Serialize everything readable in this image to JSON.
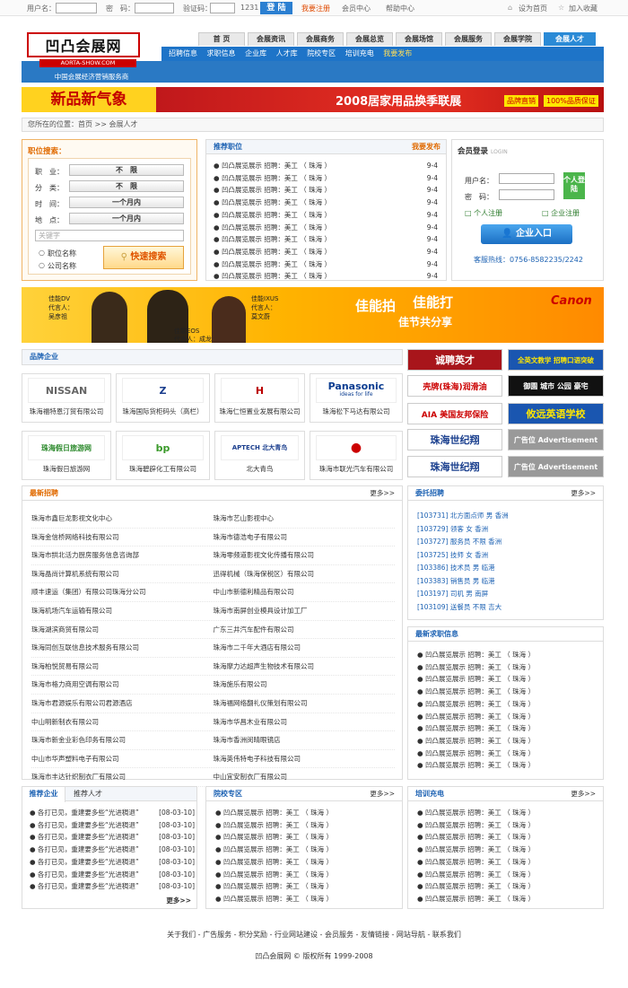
{
  "topbar": {
    "username_label": "用户名：",
    "password_label": "密　码：",
    "captcha_label": "验证码：",
    "captcha_value": "1231",
    "login_btn": "登 陆",
    "register": "我要注册",
    "member_center": "会员中心",
    "help_center": "帮助中心",
    "set_home": "设为首页",
    "add_fav": "加入收藏"
  },
  "brand": {
    "logo_text": "凹凸会展网",
    "logo_url": "AORTA-SHOW.COM",
    "tagline": "中国会展经济营销服务商"
  },
  "nav": {
    "tabs": [
      "首 页",
      "会展资讯",
      "会展商务",
      "会展总览",
      "会展场馆",
      "会展服务",
      "会展学院",
      "会展人才"
    ],
    "sub": [
      "招聘信息",
      "求职信息",
      "企业库",
      "人才库",
      "院校专区",
      "培训充电",
      "我要发布"
    ]
  },
  "banner": {
    "left": "新品新气象",
    "right": "2008居家用品换季联展",
    "badge1": "品牌直销",
    "badge2": "100%品质保证"
  },
  "breadcrumb": {
    "text": "您所在的位置：首页 >> 会展人才"
  },
  "search": {
    "title": "职位搜索：",
    "fields": [
      {
        "label": "职　业：",
        "value": "不　限"
      },
      {
        "label": "分　类：",
        "value": "不　限"
      },
      {
        "label": "时　间：",
        "value": "一个月内"
      },
      {
        "label": "地　点：",
        "value": "一个月内"
      }
    ],
    "keyword_placeholder": "关键字",
    "radio1": "职位名称",
    "radio2": "公司名称",
    "btn": "快速搜索"
  },
  "recommend": {
    "title": "推荐职位",
    "action": "我要发布",
    "rows": [
      {
        "text": "凹凸展览展示 招聘：美工 （ 珠海 ）",
        "date": "9-4"
      },
      {
        "text": "凹凸展览展示 招聘：美工 （ 珠海 ）",
        "date": "9-4"
      },
      {
        "text": "凹凸展览展示 招聘：美工 （ 珠海 ）",
        "date": "9-4"
      },
      {
        "text": "凹凸展览展示 招聘：美工 （ 珠海 ）",
        "date": "9-4"
      },
      {
        "text": "凹凸展览展示 招聘：美工 （ 珠海 ）",
        "date": "9-4"
      },
      {
        "text": "凹凸展览展示 招聘：美工 （ 珠海 ）",
        "date": "9-4"
      },
      {
        "text": "凹凸展览展示 招聘：美工 （ 珠海 ）",
        "date": "9-4"
      },
      {
        "text": "凹凸展览展示 招聘：美工 （ 珠海 ）",
        "date": "9-4"
      },
      {
        "text": "凹凸展览展示 招聘：美工 （ 珠海 ）",
        "date": "9-4"
      },
      {
        "text": "凹凸展览展示 招聘：美工 （ 珠海 ）",
        "date": "9-4"
      }
    ]
  },
  "login": {
    "title": "会员登录",
    "title_en": "LOGIN",
    "user_label": "用户名：",
    "pass_label": "密　码：",
    "btn": "个人登陆",
    "personal_reg": "个人注册",
    "company_reg": "企业注册",
    "enterprise_btn": "企业入口",
    "hotline": "客服热线：0756-8582235/2242"
  },
  "canon": {
    "text1": "佳能拍",
    "text2": "佳能打",
    "text3": "佳节共分享",
    "brand": "Canon",
    "dv": "佳能DV",
    "dv_spokes": "代言人：",
    "dv_name": "吴彦祖",
    "ixus": "佳能IXUS",
    "ixus_spokes": "代言人：",
    "ixus_name": "莫文蔚",
    "eos": "佳能EOS",
    "eos_spokes": "代言人：成龙"
  },
  "brand_co": {
    "title": "品牌企业",
    "cards": [
      {
        "logo": "NISSAN",
        "name": "珠海福特恩汀贸有限公司"
      },
      {
        "logo": "Z",
        "name": "珠海国际货柜码头（高栏）"
      },
      {
        "logo": "H",
        "name": "珠海仁恒置业发展有限公司"
      },
      {
        "logo": "Panasonic",
        "sub": "ideas for life",
        "name": "珠海松下马达有限公司"
      },
      {
        "logo": "珠海假日旅游网",
        "name": "珠海假日旅游网"
      },
      {
        "logo": "bp",
        "name": "珠海碧辟化工有限公司"
      },
      {
        "logo": "APTECH 北大青鸟",
        "name": "北大青鸟"
      },
      {
        "logo": "●",
        "name": "珠海市联光汽车有限公司"
      }
    ]
  },
  "side_ads": [
    {
      "text": "诚聘英才"
    },
    {
      "text": "全英文教学 招聘口语突破"
    },
    {
      "text": "壳牌(珠海)润滑油"
    },
    {
      "text": "御園 城市 公园 豪宅"
    },
    {
      "text": "AIA 美国友邦保险"
    },
    {
      "text": "攸远英语学校"
    },
    {
      "text": "珠海世纪翔"
    },
    {
      "text": "广告位 Advertisement"
    },
    {
      "text": "珠海世纪翔"
    },
    {
      "text": "广告位 Advertisement"
    }
  ],
  "latest": {
    "title": "最新招聘",
    "more": "更多>>",
    "rows": [
      [
        "珠海市鑫巨龙影视文化中心",
        "珠海市艺山影视中心"
      ],
      [
        "珠海金信桥网络科技有限公司",
        "珠海市德浩电子有限公司"
      ],
      [
        "珠海市拱北活力厨房服务信息咨询部",
        "珠海零频道影视文化传播有限公司"
      ],
      [
        "珠海晶尚计算机系统有限公司",
        "迅得机械（珠海保税区）有限公司"
      ],
      [
        "顺丰速运（集团）有限公司珠海分公司",
        "中山市新德利精品有限公司"
      ],
      [
        "珠海机场汽车运输有限公司",
        "珠海市南屏创业模具设计加工厂"
      ],
      [
        "珠海湖滨商贸有限公司",
        "广东三井汽车配件有限公司"
      ],
      [
        "珠海同创互联信息技术服务有限公司",
        "珠海市二千年大酒店有限公司"
      ],
      [
        "珠海柏悦贸易有限公司",
        "珠海摩力达超声生物技术有限公司"
      ],
      [
        "珠海市格力商用空调有限公司",
        "珠海施乐有限公司"
      ],
      [
        "珠海市君源娱乐有限公司君源酒店",
        "珠海福网络翻礼仪策划有限公司"
      ],
      [
        "中山明新制衣有限公司",
        "珠海市华昌木业有限公司"
      ],
      [
        "珠海市新金业彩色印务有限公司",
        "珠海市香洲闵晴眼镜店"
      ],
      [
        "中山市华声塑料电子有限公司",
        "珠海英伟特电子科技有限公司"
      ],
      [
        "珠海市丰达针织制衣厂有限公司",
        "中山宜安制衣厂有限公司"
      ]
    ]
  },
  "urgent": {
    "title": "委托招聘",
    "more": "更多>>",
    "rows": [
      "[103731] 北方面点师 男 香洲",
      "[103729] 领客 女 香洲",
      "[103727] 服务员 不限 香洲",
      "[103725] 技师 女 香洲",
      "[103386] 技术员 男 临港",
      "[103383] 销售员 男 临港",
      "[103197] 司机 男 南屏",
      "[103109] 送餐员 不限 吉大"
    ]
  },
  "resume": {
    "title": "最新求职信息",
    "rows": [
      "凹凸展览展示 招聘：美工 （ 珠海 ）",
      "凹凸展览展示 招聘：美工 （ 珠海 ）",
      "凹凸展览展示 招聘：美工 （ 珠海 ）",
      "凹凸展览展示 招聘：美工 （ 珠海 ）",
      "凹凸展览展示 招聘：美工 （ 珠海 ）",
      "凹凸展览展示 招聘：美工 （ 珠海 ）",
      "凹凸展览展示 招聘：美工 （ 珠海 ）",
      "凹凸展览展示 招聘：美工 （ 珠海 ）",
      "凹凸展览展示 招聘：美工 （ 珠海 ）",
      "凹凸展览展示 招聘：美工 （ 珠海 ）"
    ]
  },
  "rec_co": {
    "tab1": "推荐企业",
    "tab2": "推荐人才",
    "more": "更多>>",
    "rows": [
      {
        "text": "● 各打已见，重建要多些“光进稠退”",
        "date": "[08-03-10]"
      },
      {
        "text": "● 各打已见，重建要多些“光进稠退”",
        "date": "[08-03-10]"
      },
      {
        "text": "● 各打已见，重建要多些“光进稠退”",
        "date": "[08-03-10]"
      },
      {
        "text": "● 各打已见，重建要多些“光进稠退”",
        "date": "[08-03-10]"
      },
      {
        "text": "● 各打已见，重建要多些“光进稠退”",
        "date": "[08-03-10]"
      },
      {
        "text": "● 各打已见，重建要多些“光进稠退”",
        "date": "[08-03-10]"
      },
      {
        "text": "● 各打已见，重建要多些“光进稠退”",
        "date": "[08-03-10]"
      }
    ]
  },
  "school": {
    "title": "院校专区",
    "more": "更多>>",
    "rows": [
      "● 凹凸展览展示 招聘：美工 （ 珠海 ）",
      "● 凹凸展览展示 招聘：美工 （ 珠海 ）",
      "● 凹凸展览展示 招聘：美工 （ 珠海 ）",
      "● 凹凸展览展示 招聘：美工 （ 珠海 ）",
      "● 凹凸展览展示 招聘：美工 （ 珠海 ）",
      "● 凹凸展览展示 招聘：美工 （ 珠海 ）",
      "● 凹凸展览展示 招聘：美工 （ 珠海 ）",
      "● 凹凸展览展示 招聘：美工 （ 珠海 ）"
    ]
  },
  "training": {
    "title": "培训充电",
    "more": "更多>>",
    "rows": [
      "● 凹凸展览展示 招聘：美工 （ 珠海 ）",
      "● 凹凸展览展示 招聘：美工 （ 珠海 ）",
      "● 凹凸展览展示 招聘：美工 （ 珠海 ）",
      "● 凹凸展览展示 招聘：美工 （ 珠海 ）",
      "● 凹凸展览展示 招聘：美工 （ 珠海 ）",
      "● 凹凸展览展示 招聘：美工 （ 珠海 ）",
      "● 凹凸展览展示 招聘：美工 （ 珠海 ）",
      "● 凹凸展览展示 招聘：美工 （ 珠海 ）"
    ]
  },
  "footer": {
    "links": "关于我们 - 广告服务 - 积分奖励 - 行业网站建设 - 会员服务 - 友情链接 - 网站导航 - 联系我们",
    "copyright": "凹凸会展网 © 版权所有 1999-2008"
  }
}
